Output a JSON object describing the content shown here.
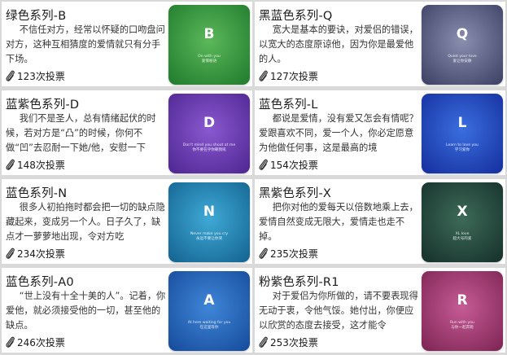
{
  "cards": [
    {
      "title": "绿色系列-B",
      "desc": "不信任对方，经常以怀疑的口吻盘问对方，这种互相猜度的爱情就只有分手下场。",
      "votes": "123次投票",
      "letter": "B",
      "caption1": "On with you",
      "caption2": "爱情秘语",
      "bg1": "#5cb85a",
      "bg2": "#1f7a2c"
    },
    {
      "title": "黑蓝色系列-Q",
      "desc": "宽大是基本的要诀，对爱侣的错误，以宽大的态度原谅他，因为你是最爱他的人。",
      "votes": "127次投票",
      "letter": "Q",
      "caption1": "Quiet your love",
      "caption2": "爱让你安静",
      "bg1": "#8a8fb0",
      "bg2": "#3b3f63"
    },
    {
      "title": "蓝紫色系列-D",
      "desc": "我们不是圣人，总有情绪起伏的时候，若对方是“凸”的时候，你何不做“凹”去忍耐一下她/他，安慰一下",
      "votes": "148次投票",
      "letter": "D",
      "caption1": "Don't mind you shout at me",
      "caption2": "你不要在乎你朝我吼",
      "bg1": "#8a58d0",
      "bg2": "#4d2590"
    },
    {
      "title": "蓝色系列-L",
      "desc": "都说是爱情，没有爱又怎会有情呢？爱跟喜欢不同，爱一个人，你必定愿意为他做任何事，这是最高的境",
      "votes": "154次投票",
      "letter": "L",
      "caption1": "Learn to love you",
      "caption2": "学习爱你",
      "bg1": "#3a6ee0",
      "bg2": "#152e9c"
    },
    {
      "title": "蓝色系列-N",
      "desc": "很多人初拍拖时都会把一切的缺点隐藏起来，变成另一个人。日子久了，缺点才一萝萝地出现，令对方吃",
      "votes": "234次投票",
      "letter": "N",
      "caption1": "Never make you cry",
      "caption2": "永远不要让你哭",
      "bg1": "#3fa9d6",
      "bg2": "#13628f"
    },
    {
      "title": "黑紫色系列-X",
      "desc": "把你对他的爱每天以倍数地乘上去，爱情自然变成无限大，爱情走也走不掉。",
      "votes": "235次投票",
      "letter": "X",
      "caption1": "XL love",
      "caption2": "超大号的爱",
      "bg1": "#3d6a58",
      "bg2": "#15302a"
    },
    {
      "title": "蓝色系列-A0",
      "desc": "“世上没有十全十美的人”。记着，你爱他，就必须接受他的一切，甚至他的缺点。",
      "votes": "246次投票",
      "letter": "A",
      "caption1": "At here waiting for you",
      "caption2": "在这里等你",
      "bg1": "#3f86d8",
      "bg2": "#164a9a"
    },
    {
      "title": "粉紫色系列-R1",
      "desc": "对于爱侣为你所做的，请不要表现得无动于衷，令他气馁。她付出，你便应以欣赏的态度去接受，这才能令",
      "votes": "253次投票",
      "letter": "R",
      "caption1": "Run with you",
      "caption2": "与你一起奔跑",
      "bg1": "#c65b95",
      "bg2": "#7c2453"
    }
  ]
}
